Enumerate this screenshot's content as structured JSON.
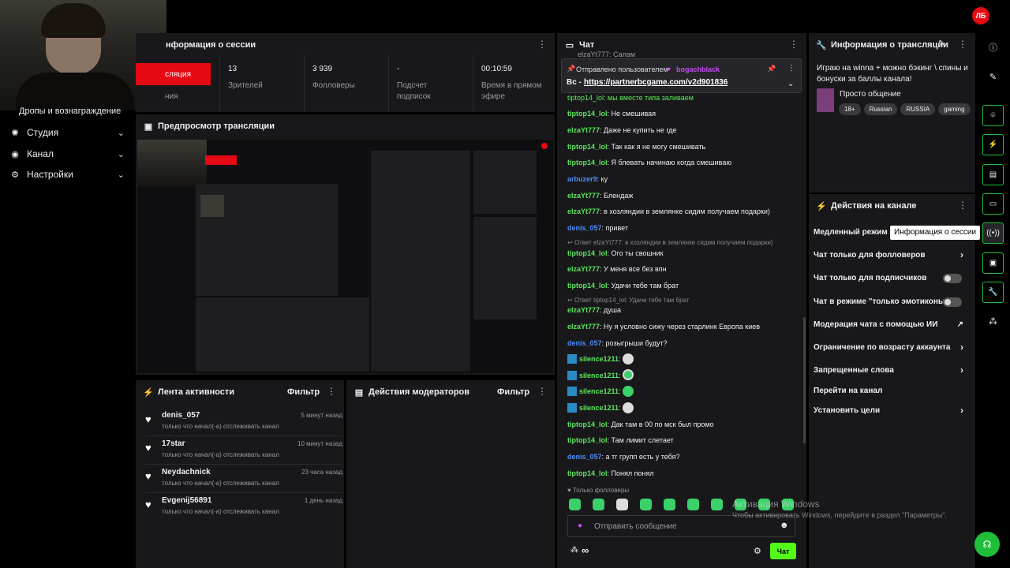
{
  "logo": "ЛБ",
  "sidebar": {
    "partial_item": "Дропы и вознаграждение",
    "items": [
      {
        "label": "Студия",
        "icon": "studio-icon"
      },
      {
        "label": "Канал",
        "icon": "channel-icon"
      },
      {
        "label": "Настройки",
        "icon": "gear-icon"
      }
    ]
  },
  "session": {
    "title": "нформация о сессии",
    "live_button": "сляция",
    "live_sub": "ния",
    "stats": [
      {
        "value": "13",
        "label": "Зрителей"
      },
      {
        "value": "3 939",
        "label": "Фолловеры"
      },
      {
        "value": "-",
        "label": "Подсчет подписок"
      },
      {
        "value": "00:10:59",
        "label": "Время в прямом эфире"
      }
    ]
  },
  "preview": {
    "title": "Предпросмотр трансляции"
  },
  "activity": {
    "title": "Лента активности",
    "filter": "Фильтр",
    "items": [
      {
        "name": "denis_057",
        "time": "5 минут назад",
        "desc": "только что начал(-а) отслеживать канал"
      },
      {
        "name": "17star",
        "time": "10 минут назад",
        "desc": "только что начал(-а) отслеживать канал"
      },
      {
        "name": "Neydachnick",
        "time": "23 часа назад",
        "desc": "только что начал(-а) отслеживать канал"
      },
      {
        "name": "Evgenij56891",
        "time": "1 день назад",
        "desc": "только что начал(-а) отслеживать канал"
      }
    ]
  },
  "mod_actions": {
    "title": "Действия модераторов",
    "filter": "Фильтр"
  },
  "chat": {
    "title": "Чат",
    "top_partial": "elzaYt777: Салам",
    "pinned": {
      "by_label": "Отправлено пользователем",
      "by_user": "bogachblack",
      "text_prefix": "Вс - ",
      "link": "https://partnerbcgame.com/v2d901836"
    },
    "partial_msg": "tiptop14_lol: мы вместе типа заливаем",
    "messages": [
      {
        "user": "tiptop14_lol",
        "color": "#5ce65c",
        "text": "Не смешивая"
      },
      {
        "user": "elzaYt777",
        "color": "#5ce65c",
        "text": "Даже не купить не где"
      },
      {
        "user": "tiptop14_lol",
        "color": "#5ce65c",
        "text": "Так как я не могу смешивать"
      },
      {
        "user": "tiptop14_lol",
        "color": "#5ce65c",
        "text": "Я блевать начинаю когда смешиваю"
      },
      {
        "user": "arbuzer9",
        "color": "#4c8df6",
        "text": "ку"
      },
      {
        "user": "elzaYt777",
        "color": "#5ce65c",
        "text": "Блендаж"
      },
      {
        "user": "elzaYt777",
        "color": "#5ce65c",
        "text": "в хозляндии в землянке сидим получаем подарки)"
      },
      {
        "user": "denis_057",
        "color": "#4c8df6",
        "text": "привет"
      },
      {
        "user": "tiptop14_lol",
        "color": "#5ce65c",
        "text": "Ого ты свошник"
      },
      {
        "user": "elzaYt777",
        "color": "#5ce65c",
        "text": "У меня все без впн"
      },
      {
        "user": "tiptop14_lol",
        "color": "#5ce65c",
        "text": "Удачи тебе там брат"
      },
      {
        "user": "elzaYt777",
        "color": "#5ce65c",
        "text": "душа"
      },
      {
        "user": "elzaYt777",
        "color": "#5ce65c",
        "text": "Ну я условно сижу через старлинк Европа киев"
      },
      {
        "user": "denis_057",
        "color": "#4c8df6",
        "text": "розыгрыши будут?"
      },
      {
        "user": "silence1211",
        "color": "#5ce65c",
        "text": ""
      },
      {
        "user": "silence1211",
        "color": "#5ce65c",
        "text": ""
      },
      {
        "user": "silence1211",
        "color": "#5ce65c",
        "text": ""
      },
      {
        "user": "silence1211",
        "color": "#5ce65c",
        "text": ""
      },
      {
        "user": "tiptop14_lol",
        "color": "#5ce65c",
        "text": "Дак там в 00 по мск был промо"
      },
      {
        "user": "tiptop14_lol",
        "color": "#5ce65c",
        "text": "Там лимит слетает"
      },
      {
        "user": "denis_057",
        "color": "#4c8df6",
        "text": "а тг групп есть у тебя?"
      },
      {
        "user": "tiptop14_lol",
        "color": "#5ce65c",
        "text": "Понял понял"
      }
    ],
    "replies": [
      "Ответ elzaYt777: в хозляндии в землянке сидим получаем подарки)",
      "Ответ tiptop14_lol: Удачи тебе там брат"
    ],
    "followers_only": "Только фолловеры",
    "input_placeholder": "Отправить сообщение",
    "infinity": "∞",
    "send_button": "Чат"
  },
  "stream_info": {
    "title": "Информация о трансляции",
    "headline": "Играю на winna + можно бэкинг \\ спины и бонуски за баллы канала!",
    "category": "Просто общение",
    "tags": [
      "18+",
      "Russian",
      "RUSSIA",
      "gaming"
    ]
  },
  "channel_actions": {
    "title": "Действия на канале",
    "items": [
      {
        "label": "Медленный режим",
        "control": "none"
      },
      {
        "label": "Чат только для фолловеров",
        "control": "chevron"
      },
      {
        "label": "Чат только для подписчиков",
        "control": "toggle"
      },
      {
        "label": "Чат в режиме \"только эмотиконы\"",
        "control": "toggle"
      },
      {
        "label": "Модерация чата с помощью ИИ",
        "control": "external"
      },
      {
        "label": "Ограничение по возрасту аккаунта",
        "control": "chevron"
      },
      {
        "label": "Запрещенные слова",
        "control": "chevron"
      },
      {
        "label": "Перейти на канал",
        "control": "none"
      },
      {
        "label": "Установить цели",
        "control": "chevron"
      }
    ],
    "tooltip": "Информация о сессии"
  },
  "watermark": {
    "line1": "Активация Windows",
    "line2": "Чтобы активировать Windows, перейдите в раздел \"Параметры\"."
  },
  "colors": {
    "accent": "#1fbf3a",
    "live": "#e50914",
    "blue_user": "#4c8df6",
    "green_user": "#5ce65c",
    "panel": "#18181b"
  }
}
